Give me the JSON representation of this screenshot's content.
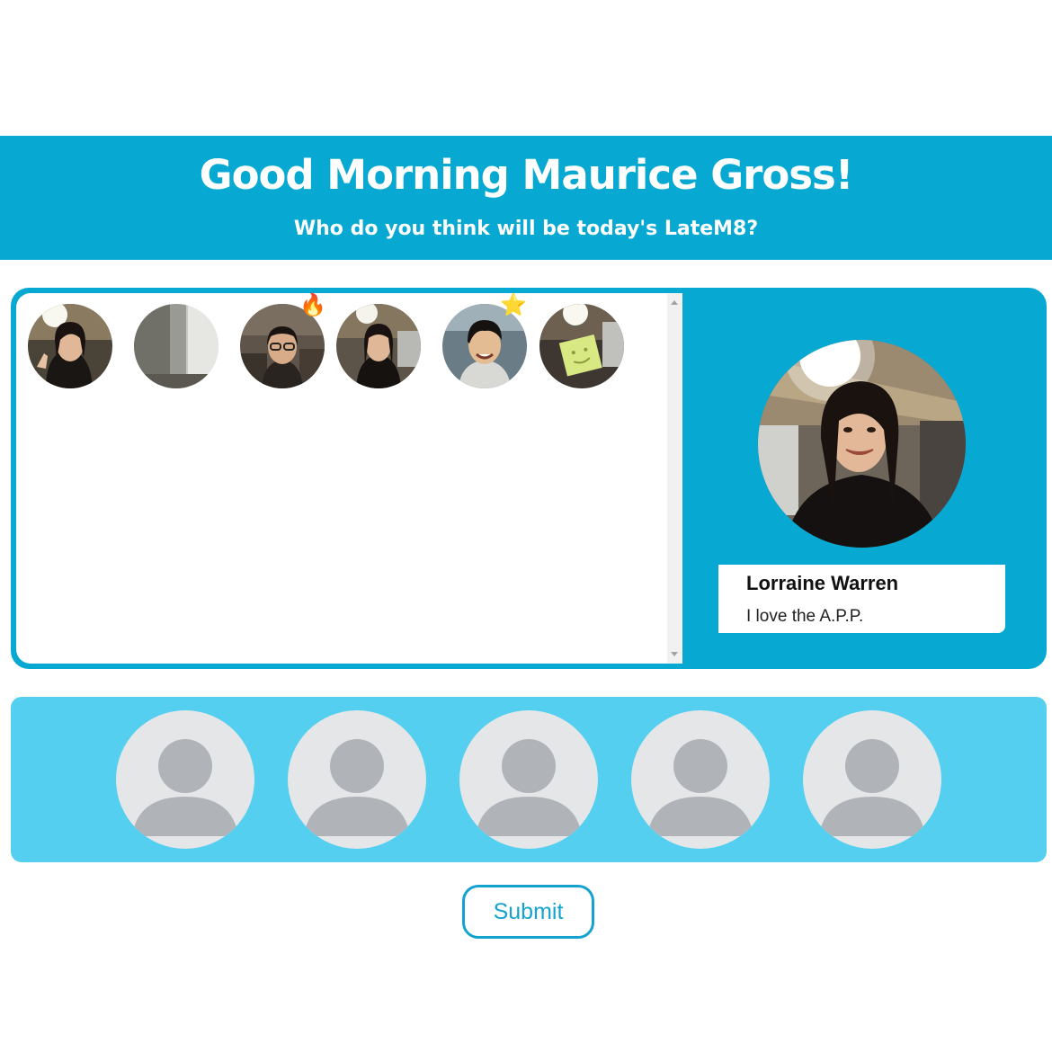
{
  "header": {
    "greeting": "Good Morning Maurice Gross!",
    "question": "Who do you think will be today's LateM8?"
  },
  "pool": {
    "avatars": [
      {
        "name": "Lorraine Warren",
        "badge": ""
      },
      {
        "name": "",
        "badge": ""
      },
      {
        "name": "",
        "badge": "🔥"
      },
      {
        "name": "",
        "badge": ""
      },
      {
        "name": "",
        "badge": "⭐"
      },
      {
        "name": "",
        "badge": ""
      }
    ]
  },
  "profile": {
    "name": "Lorraine Warren",
    "bio": "I love the A.P.P."
  },
  "guesses": {
    "slots": [
      "empty",
      "empty",
      "empty",
      "empty",
      "empty"
    ]
  },
  "submit_label": "Submit",
  "colors": {
    "primary": "#07a9d2",
    "secondary": "#54cff0",
    "placeholder": "#e4e6e8",
    "placeholder_figure": "#b0b4b8"
  }
}
